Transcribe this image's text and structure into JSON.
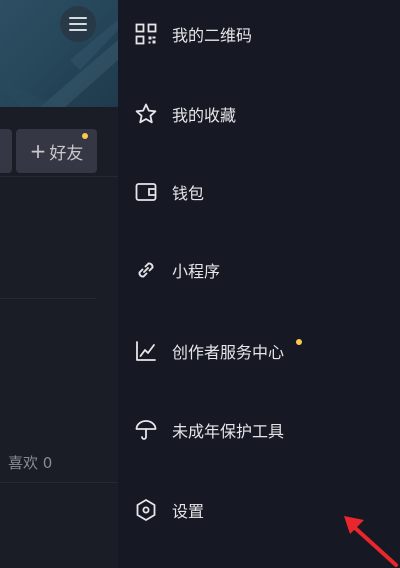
{
  "background": {
    "add_friend_label": "好友",
    "likes_text": "喜欢 0"
  },
  "drawer": {
    "items": [
      {
        "label": "我的二维码",
        "icon": "qr-code-icon"
      },
      {
        "label": "我的收藏",
        "icon": "star-icon"
      },
      {
        "label": "钱包",
        "icon": "wallet-icon"
      },
      {
        "label": "小程序",
        "icon": "link-icon"
      },
      {
        "label": "创作者服务中心",
        "icon": "chart-icon",
        "badge": true
      },
      {
        "label": "未成年保护工具",
        "icon": "umbrella-icon"
      },
      {
        "label": "设置",
        "icon": "settings-hexagon-icon"
      }
    ]
  },
  "colors": {
    "background": "#161823",
    "text": "#e6e6e8",
    "badge": "#facb4a",
    "arrow": "#e8262b"
  }
}
